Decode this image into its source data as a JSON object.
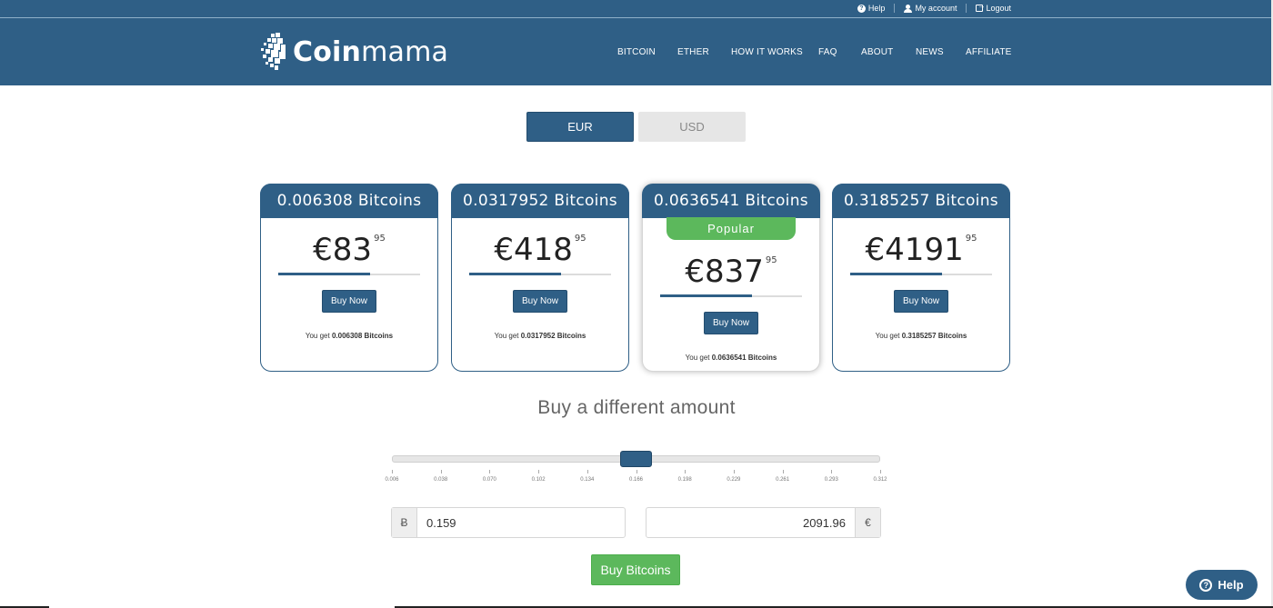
{
  "topbar": {
    "help": "Help",
    "account": "My account",
    "logout": "Logout"
  },
  "logo": {
    "bold": "Coin",
    "light": "mama"
  },
  "nav": [
    "BITCOIN",
    "ETHER",
    "HOW IT WORKS",
    "FAQ",
    "ABOUT",
    "NEWS",
    "AFFILIATE"
  ],
  "currency": {
    "eur": "EUR",
    "usd": "USD",
    "selected": "EUR"
  },
  "cards": [
    {
      "title": "0.006308 Bitcoins",
      "price_main": "€83",
      "price_cents": "95",
      "bar_fill_pct": 65,
      "button": "Buy Now",
      "you_get_prefix": "You get",
      "you_get_amount": "0.006308 Bitcoins"
    },
    {
      "title": "0.0317952 Bitcoins",
      "price_main": "€418",
      "price_cents": "95",
      "bar_fill_pct": 65,
      "button": "Buy Now",
      "you_get_prefix": "You get",
      "you_get_amount": "0.0317952 Bitcoins"
    },
    {
      "title": "0.0636541 Bitcoins",
      "popular": "Popular",
      "price_main": "€837",
      "price_cents": "95",
      "bar_fill_pct": 65,
      "button": "Buy Now",
      "you_get_prefix": "You get",
      "you_get_amount": "0.0636541 Bitcoins"
    },
    {
      "title": "0.3185257 Bitcoins",
      "price_main": "€4191",
      "price_cents": "95",
      "bar_fill_pct": 65,
      "button": "Buy Now",
      "you_get_prefix": "You get",
      "you_get_amount": "0.3185257 Bitcoins"
    }
  ],
  "custom": {
    "title": "Buy a different amount",
    "slider_value": 0.159,
    "slider_min": 0.006,
    "slider_max": 0.312,
    "ticks": [
      "0.006",
      "0.038",
      "0.070",
      "0.102",
      "0.134",
      "0.166",
      "0.198",
      "0.229",
      "0.261",
      "0.293",
      "0.312"
    ],
    "btc_symbol": "Ƀ",
    "btc_value": "0.159",
    "eur_symbol": "€",
    "eur_value": "2091.96",
    "buy_button": "Buy Bitcoins"
  },
  "help_widget": {
    "label": "Help"
  },
  "colors": {
    "brand": "#2f5f86",
    "success": "#5cb85c",
    "inactive": "#e6e6e6"
  }
}
